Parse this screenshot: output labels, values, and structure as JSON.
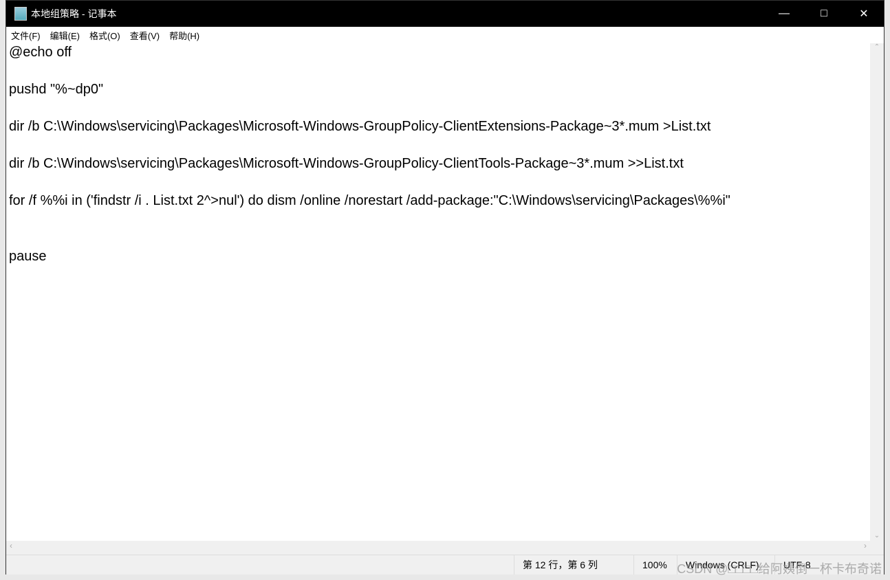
{
  "window": {
    "title": "本地组策略 - 记事本"
  },
  "menu": [
    "文件(F)",
    "编辑(E)",
    "格式(O)",
    "查看(V)",
    "帮助(H)"
  ],
  "content": "@echo off\n\npushd \"%~dp0\"\n\ndir /b C:\\Windows\\servicing\\Packages\\Microsoft-Windows-GroupPolicy-ClientExtensions-Package~3*.mum >List.txt\n\ndir /b C:\\Windows\\servicing\\Packages\\Microsoft-Windows-GroupPolicy-ClientTools-Package~3*.mum >>List.txt\n\nfor /f %%i in ('findstr /i . List.txt 2^>nul') do dism /online /norestart /add-package:\"C:\\Windows\\servicing\\Packages\\%%i\"\n\n\npause",
  "status": {
    "position": "第 12 行，第 6 列",
    "zoom": "100%",
    "line_ending": "Windows (CRLF)",
    "encoding": "UTF-8"
  },
  "watermark": "CSDN @□□□□给阿姨倒一杯卡布奇诺"
}
